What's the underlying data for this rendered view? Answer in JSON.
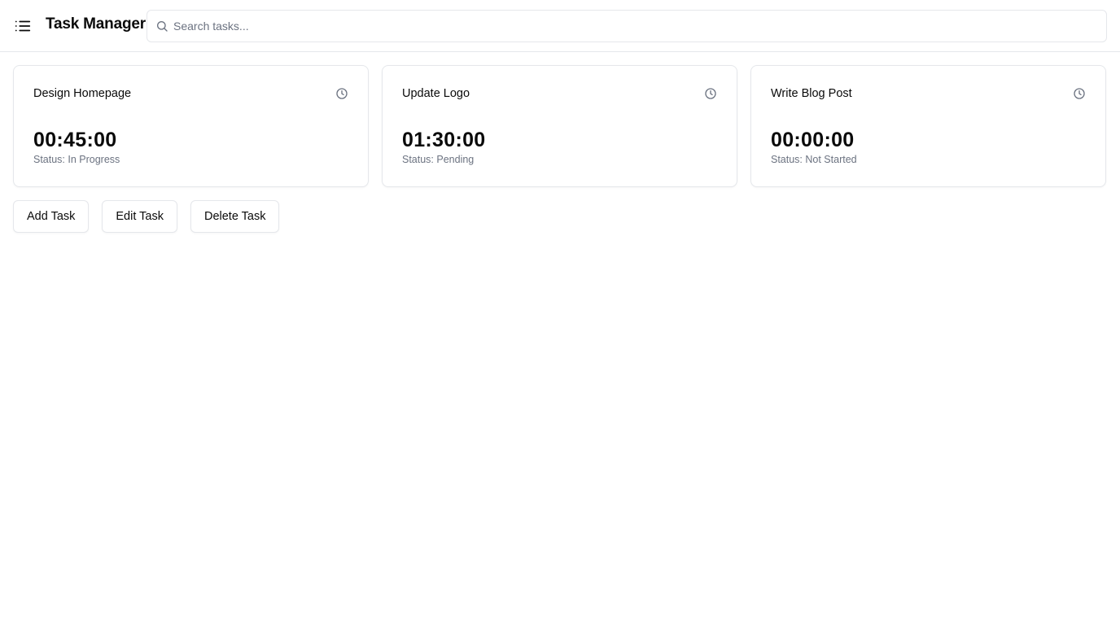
{
  "header": {
    "menu_icon": "list-icon",
    "title": "Task Manager",
    "search": {
      "icon": "search-icon",
      "placeholder": "Search tasks...",
      "value": ""
    }
  },
  "tasks": [
    {
      "title": "Design Homepage",
      "icon": "clock-icon",
      "time": "00:45:00",
      "status": "Status: In Progress"
    },
    {
      "title": "Update Logo",
      "icon": "clock-icon",
      "time": "01:30:00",
      "status": "Status: Pending"
    },
    {
      "title": "Write Blog Post",
      "icon": "clock-icon",
      "time": "00:00:00",
      "status": "Status: Not Started"
    }
  ],
  "actions": {
    "add_label": "Add Task",
    "edit_label": "Edit Task",
    "delete_label": "Delete Task"
  },
  "colors": {
    "border": "#e5e7eb",
    "text": "#0a0a0a",
    "muted": "#6b7280",
    "background": "#ffffff"
  }
}
